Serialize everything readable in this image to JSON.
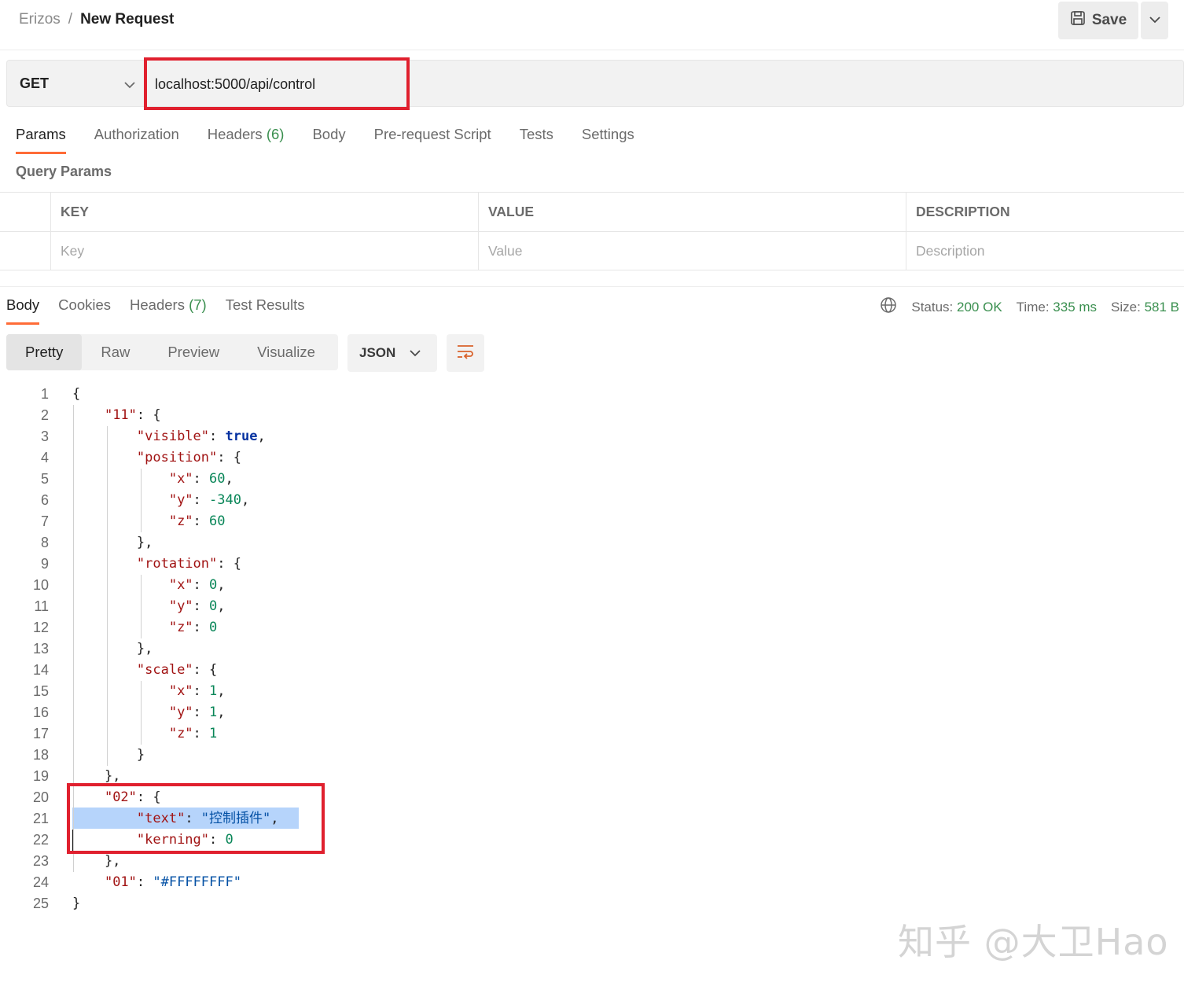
{
  "breadcrumb": {
    "workspace": "Erizos",
    "separator": "/",
    "current": "New Request"
  },
  "toolbar": {
    "save_label": "Save"
  },
  "request": {
    "method": "GET",
    "url": "localhost:5000/api/control"
  },
  "request_tabs": [
    {
      "label": "Params",
      "count": ""
    },
    {
      "label": "Authorization",
      "count": ""
    },
    {
      "label": "Headers",
      "count": "(6)"
    },
    {
      "label": "Body",
      "count": ""
    },
    {
      "label": "Pre-request Script",
      "count": ""
    },
    {
      "label": "Tests",
      "count": ""
    },
    {
      "label": "Settings",
      "count": ""
    }
  ],
  "query_params": {
    "title": "Query Params",
    "headers": [
      "KEY",
      "VALUE",
      "DESCRIPTION"
    ],
    "placeholders": {
      "key": "Key",
      "value": "Value",
      "description": "Description"
    }
  },
  "response_tabs": [
    {
      "label": "Body",
      "count": ""
    },
    {
      "label": "Cookies",
      "count": ""
    },
    {
      "label": "Headers",
      "count": "(7)"
    },
    {
      "label": "Test Results",
      "count": ""
    }
  ],
  "status": {
    "status_label": "Status:",
    "status_value": "200 OK",
    "time_label": "Time:",
    "time_value": "335 ms",
    "size_label": "Size:",
    "size_value": "581 B"
  },
  "view_modes": [
    "Pretty",
    "Raw",
    "Preview",
    "Visualize"
  ],
  "format": "JSON",
  "code_lines": [
    "{",
    "    \"11\": {",
    "        \"visible\": true,",
    "        \"position\": {",
    "            \"x\": 60,",
    "            \"y\": -340,",
    "            \"z\": 60",
    "        },",
    "        \"rotation\": {",
    "            \"x\": 0,",
    "            \"y\": 0,",
    "            \"z\": 0",
    "        },",
    "        \"scale\": {",
    "            \"x\": 1,",
    "            \"y\": 1,",
    "            \"z\": 1",
    "        }",
    "    },",
    "    \"02\": {",
    "        \"text\": \"控制插件\",",
    "        \"kerning\": 0",
    "    },",
    "    \"01\": \"#FFFFFFFF\"",
    "}"
  ],
  "watermark": "知乎 @大卫Hao",
  "colors": {
    "accent": "#ff6c37",
    "highlight": "#e0202e",
    "success": "#3a8f4f"
  }
}
